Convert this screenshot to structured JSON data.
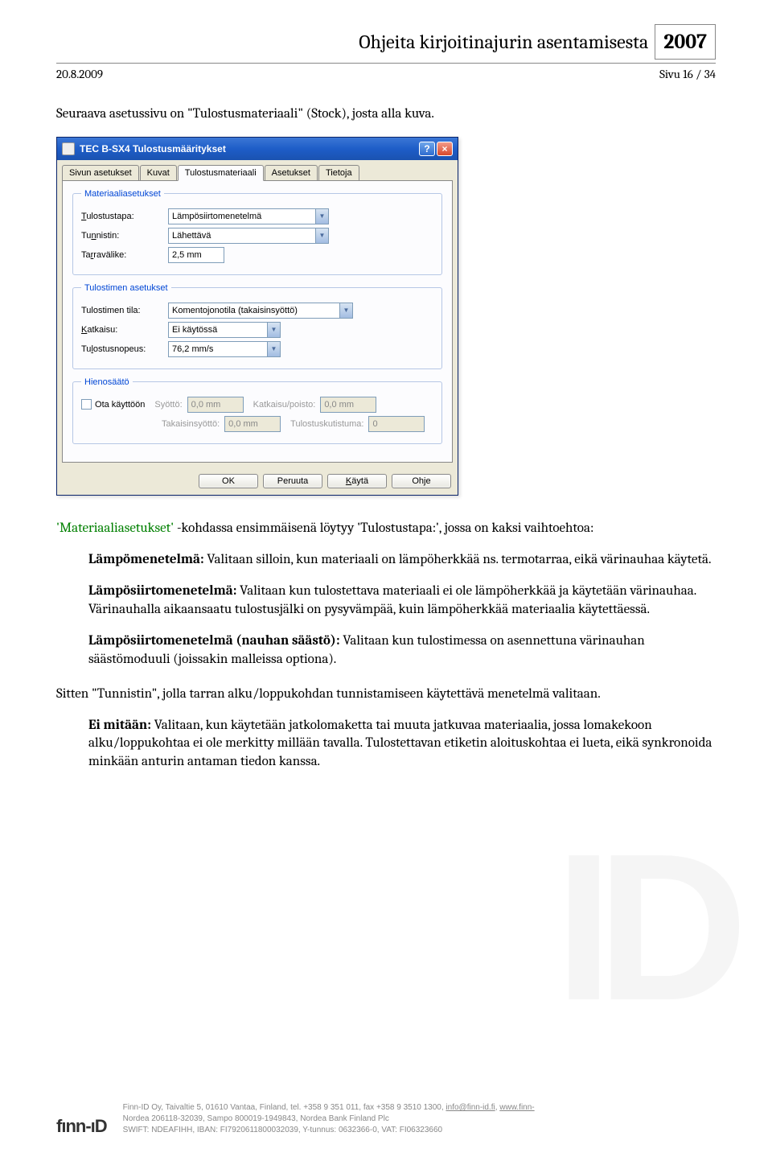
{
  "header": {
    "title": "Ohjeita kirjoitinajurin asentamisesta",
    "year": "2007",
    "date": "20.8.2009",
    "page_info": "Sivu 16 / 34"
  },
  "intro": "Seuraava asetussivu on \"Tulostusmateriaali\" (Stock), josta alla kuva.",
  "dialog": {
    "title": "TEC B-SX4 Tulostusmääritykset",
    "tabs": {
      "t0": "Sivun asetukset",
      "t1": "Kuvat",
      "t2": "Tulostusmateriaali",
      "t3": "Asetukset",
      "t4": "Tietoja"
    },
    "group_mat": {
      "legend": "Materiaaliasetukset",
      "tulostustapa_lbl": "Tulostustapa:",
      "tulostustapa_val": "Lämpösiirtomenetelmä",
      "tunnistin_lbl": "Tunnistin:",
      "tunnistin_val": "Lähettävä",
      "tarravalike_lbl": "Tarravälike:",
      "tarravalike_val": "2,5 mm"
    },
    "group_tul": {
      "legend": "Tulostimen asetukset",
      "tila_lbl": "Tulostimen tila:",
      "tila_val": "Komentojonotila (takaisinsyöttö)",
      "katkaisu_lbl": "Katkaisu:",
      "katkaisu_val": "Ei käytössä",
      "nopeus_lbl": "Tulostusnopeus:",
      "nopeus_val": "76,2 mm/s"
    },
    "group_hs": {
      "legend": "Hienosäätö",
      "ota_lbl": "Ota käyttöön",
      "syotto_lbl": "Syöttö:",
      "syotto_val": "0,0 mm",
      "takaisin_lbl": "Takaisinsyöttö:",
      "takaisin_val": "0,0 mm",
      "katkpoisto_lbl": "Katkaisu/poisto:",
      "katkpoisto_val": "0,0 mm",
      "kutistuma_lbl": "Tulostuskutistuma:",
      "kutistuma_val": "0"
    },
    "buttons": {
      "ok": "OK",
      "peruuta": "Peruuta",
      "kayta": "Käytä",
      "ohje": "Ohje"
    }
  },
  "body": {
    "p1a": "'Materiaaliasetukset'",
    "p1b": " -kohdassa ensimmäisenä löytyy 'Tulostustapa:', jossa on kaksi vaihtoehtoa:",
    "lampo_hdr": "Lämpömenetelmä:",
    "lampo_txt": " Valitaan silloin, kun materiaali on lämpöherkkää ns. termotarraa, eikä värinauhaa käytetä.",
    "siirto_hdr": "Lämpösiirtomenetelmä:",
    "siirto_txt": " Valitaan kun tulostettava materiaali ei ole lämpöherkkää ja käytetään värinauhaa. Värinauhalla aikaansaatu tulostusjälki on pysyvämpää, kuin lämpöherkkää materiaalia käytettäessä.",
    "saasto_hdr": "Lämpösiirtomenetelmä (nauhan säästö):",
    "saasto_txt": " Valitaan kun tulostimessa on asennettuna värinauhan säästömoduuli (joissakin malleissa optiona).",
    "p2": "Sitten \"Tunnistin\", jolla tarran alku/loppukohdan tunnistamiseen käytettävä menetelmä valitaan.",
    "eimit_hdr": "Ei mitään:",
    "eimit_txt": " Valitaan, kun käytetään jatkolomaketta tai muuta jatkuvaa materiaalia, jossa lomakekoon alku/loppukohtaa ei ole merkitty millään tavalla. Tulostettavan etiketin aloituskohtaa ei lueta, eikä synkronoida minkään anturin antaman tiedon kanssa."
  },
  "footer": {
    "logo": "fınn-ıD",
    "line1a": "Finn-ID Oy, Taivaltie 5, 01610 Vantaa, Finland, tel. +358 9 351 011, fax +358 9 3510 1300, ",
    "line1_link1": "info@finn-id.fi",
    "line1_sep": ", ",
    "line1_link2": "www.finn-",
    "line2": "Nordea 206118-32039, Sampo 800019-1949843, Nordea Bank Finland Plc",
    "line3": "SWIFT: NDEAFIHH, IBAN: FI7920611800032039, Y-tunnus: 0632366-0, VAT: FI06323660"
  }
}
